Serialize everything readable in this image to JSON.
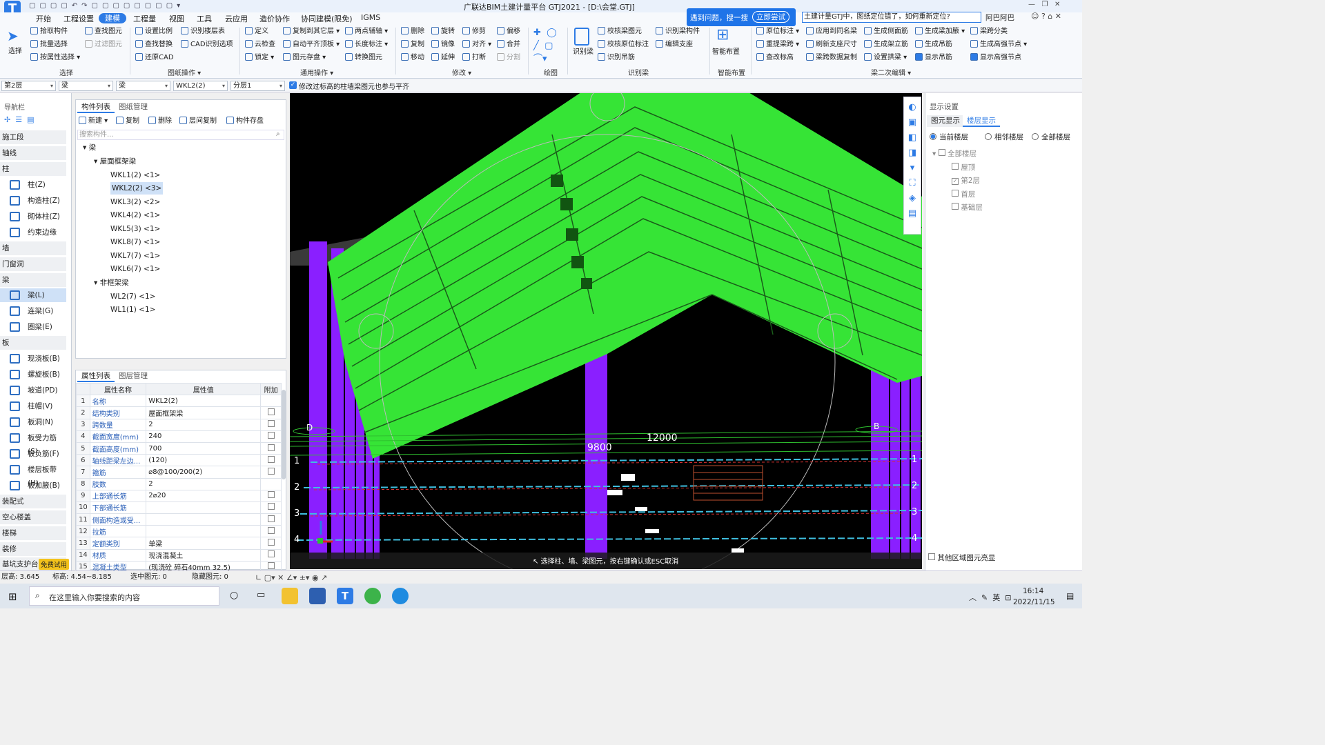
{
  "app": {
    "title": "广联达BIM土建计量平台 GTJ2021 - [D:\\会堂.GTJ]",
    "user": "阿巴阿巴",
    "search_prompt": "遇到问题，搜一搜",
    "search_try": "立即尝试",
    "search_text": "土建计量GTJ中，图纸定位错了，如何重新定位?"
  },
  "menu": [
    "开始",
    "工程设置",
    "建模",
    "工程量",
    "视图",
    "工具",
    "云应用",
    "造价协作",
    "协同建模(限免)",
    "IGMS"
  ],
  "ribbon": {
    "select": [
      "选择",
      "拾取构件",
      "批量选择",
      "按属性选择",
      "查找图元",
      "过滤图元"
    ],
    "drawing": [
      "设置比例",
      "识别楼层表",
      "查找替换",
      "CAD识别选项",
      "还原CAD"
    ],
    "common": [
      "定义",
      "复制到其它层",
      "两点辅轴",
      "云检查",
      "自动平齐顶板",
      "长度标注",
      "锁定",
      "图元存盘",
      "转换图元"
    ],
    "modify": [
      "删除",
      "旋转",
      "修剪",
      "偏移",
      "复制",
      "镜像",
      "对齐",
      "合并",
      "移动",
      "延伸",
      "打断",
      "分割"
    ],
    "recog": [
      "识别梁",
      "校核梁图元",
      "识别梁构件",
      "校核原位标注",
      "编辑支座",
      "识别吊筋"
    ],
    "smart": "智能布置",
    "beam2": [
      "原位标注",
      "应用到同名梁",
      "生成侧面筋",
      "生成梁加腋",
      "梁跨分类",
      "重提梁跨",
      "刷新支座尺寸",
      "生成架立筋",
      "生成吊筋",
      "生成高强节点",
      "查改标高",
      "梁跨数据复制",
      "设置拱梁",
      "显示吊筋",
      "显示高强节点"
    ],
    "groups": [
      "选择",
      "图纸操作",
      "通用操作",
      "修改",
      "绘图",
      "识别梁",
      "智能布置",
      "梁二次编辑"
    ]
  },
  "selbar": {
    "floor": "第2层",
    "type1": "梁",
    "type2": "梁",
    "comp": "WKL2(2)",
    "layer": "分层1",
    "option": "修改过标高的柱墙梁图元也参与平齐"
  },
  "nav": {
    "title": "导航栏",
    "items": [
      "施工段",
      "轴线",
      "柱",
      "柱(Z)",
      "构造柱(Z)",
      "砌体柱(Z)",
      "约束边缘非...",
      "墙",
      "门窗洞",
      "梁",
      "梁(L)",
      "连梁(G)",
      "圈梁(E)",
      "板",
      "现浇板(B)",
      "螺旋板(B)",
      "坡道(PD)",
      "柱帽(V)",
      "板洞(N)",
      "板受力筋(S)",
      "板负筋(F)",
      "楼层板带(H)",
      "板加腋(B)",
      "装配式",
      "空心楼盖",
      "楼梯",
      "装修",
      "基坑支护台"
    ],
    "trial": "免费试用"
  },
  "complist": {
    "tabs": [
      "构件列表",
      "图纸管理"
    ],
    "toolbar": [
      "新建",
      "复制",
      "删除",
      "层间复制",
      "构件存盘"
    ],
    "search": "搜索构件...",
    "root": "梁",
    "group1": "屋面框架梁",
    "group2": "非框架梁",
    "items": [
      [
        "WKL1(2)",
        "<1>"
      ],
      [
        "WKL2(2)",
        "<3>"
      ],
      [
        "WKL3(2)",
        "<2>"
      ],
      [
        "WKL4(2)",
        "<1>"
      ],
      [
        "WKL5(3)",
        "<1>"
      ],
      [
        "WKL8(7)",
        "<1>"
      ],
      [
        "WKL7(7)",
        "<1>"
      ],
      [
        "WKL6(7)",
        "<1>"
      ]
    ],
    "items2": [
      [
        "WL2(7)",
        "<1>"
      ],
      [
        "WL1(1)",
        "<1>"
      ]
    ]
  },
  "props": {
    "tabs": [
      "属性列表",
      "图层管理"
    ],
    "head": [
      "属性名称",
      "属性值",
      "附加"
    ],
    "rows": [
      [
        "1",
        "名称",
        "WKL2(2)",
        false
      ],
      [
        "2",
        "结构类别",
        "屋面框架梁",
        true
      ],
      [
        "3",
        "跨数量",
        "2",
        true
      ],
      [
        "4",
        "截面宽度(mm)",
        "240",
        true
      ],
      [
        "5",
        "截面高度(mm)",
        "700",
        true
      ],
      [
        "6",
        "轴线距梁左边...",
        "(120)",
        true
      ],
      [
        "7",
        "箍筋",
        "⌀8@100/200(2)",
        true
      ],
      [
        "8",
        "肢数",
        "2",
        false
      ],
      [
        "9",
        "上部通长筋",
        "2⌀20",
        true
      ],
      [
        "10",
        "下部通长筋",
        "",
        true
      ],
      [
        "11",
        "侧面构造或受...",
        "",
        true
      ],
      [
        "12",
        "拉筋",
        "",
        true
      ],
      [
        "13",
        "定额类别",
        "单梁",
        true
      ],
      [
        "14",
        "材质",
        "现浇混凝土",
        true
      ],
      [
        "15",
        "混凝土类型",
        "(现浇砼 碎石40mm 32.5)",
        true
      ]
    ]
  },
  "viewport": {
    "dims": [
      "9800",
      "12000"
    ],
    "axes_left": [
      "1",
      "2",
      "3",
      "4"
    ],
    "axes_right": [
      "1",
      "2",
      "3",
      "4"
    ],
    "axis_tags": [
      "D",
      "B"
    ],
    "hint": "选择柱、墙、梁图元，按右键确认或ESC取消"
  },
  "display": {
    "title": "显示设置",
    "tabs": [
      "图元显示",
      "楼层显示"
    ],
    "radios": [
      "当前楼层",
      "相邻楼层",
      "全部楼层"
    ],
    "all": "全部楼层",
    "floors": [
      "屋顶",
      "第2层",
      "首层",
      "基础层"
    ],
    "other": "其他区域图元亮显"
  },
  "status": {
    "floor_h": "层高:  3.645",
    "elev": "标高:  4.54~8.185",
    "selected": "选中图元: 0",
    "hidden": "隐藏图元: 0"
  },
  "taskbar": {
    "search": "在这里输入你要搜索的内容",
    "time": "16:14",
    "date": "2022/11/15",
    "ime": "英"
  },
  "colors": {
    "accent": "#2d7be5",
    "beam": "#33e833",
    "column": "#8a1fff",
    "bg": "#000000"
  }
}
